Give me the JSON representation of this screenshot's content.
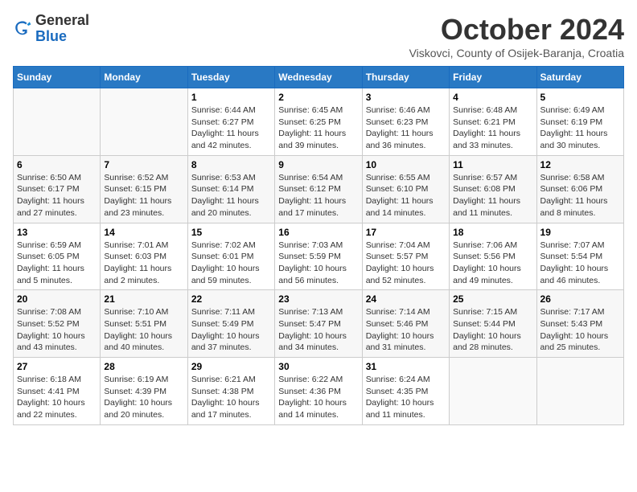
{
  "header": {
    "logo_general": "General",
    "logo_blue": "Blue",
    "month_title": "October 2024",
    "subtitle": "Viskovci, County of Osijek-Baranja, Croatia"
  },
  "calendar": {
    "days_of_week": [
      "Sunday",
      "Monday",
      "Tuesday",
      "Wednesday",
      "Thursday",
      "Friday",
      "Saturday"
    ],
    "weeks": [
      [
        {
          "day": "",
          "sunrise": "",
          "sunset": "",
          "daylight": "",
          "empty": true
        },
        {
          "day": "",
          "sunrise": "",
          "sunset": "",
          "daylight": "",
          "empty": true
        },
        {
          "day": "1",
          "sunrise": "Sunrise: 6:44 AM",
          "sunset": "Sunset: 6:27 PM",
          "daylight": "Daylight: 11 hours and 42 minutes.",
          "empty": false
        },
        {
          "day": "2",
          "sunrise": "Sunrise: 6:45 AM",
          "sunset": "Sunset: 6:25 PM",
          "daylight": "Daylight: 11 hours and 39 minutes.",
          "empty": false
        },
        {
          "day": "3",
          "sunrise": "Sunrise: 6:46 AM",
          "sunset": "Sunset: 6:23 PM",
          "daylight": "Daylight: 11 hours and 36 minutes.",
          "empty": false
        },
        {
          "day": "4",
          "sunrise": "Sunrise: 6:48 AM",
          "sunset": "Sunset: 6:21 PM",
          "daylight": "Daylight: 11 hours and 33 minutes.",
          "empty": false
        },
        {
          "day": "5",
          "sunrise": "Sunrise: 6:49 AM",
          "sunset": "Sunset: 6:19 PM",
          "daylight": "Daylight: 11 hours and 30 minutes.",
          "empty": false
        }
      ],
      [
        {
          "day": "6",
          "sunrise": "Sunrise: 6:50 AM",
          "sunset": "Sunset: 6:17 PM",
          "daylight": "Daylight: 11 hours and 27 minutes.",
          "empty": false
        },
        {
          "day": "7",
          "sunrise": "Sunrise: 6:52 AM",
          "sunset": "Sunset: 6:15 PM",
          "daylight": "Daylight: 11 hours and 23 minutes.",
          "empty": false
        },
        {
          "day": "8",
          "sunrise": "Sunrise: 6:53 AM",
          "sunset": "Sunset: 6:14 PM",
          "daylight": "Daylight: 11 hours and 20 minutes.",
          "empty": false
        },
        {
          "day": "9",
          "sunrise": "Sunrise: 6:54 AM",
          "sunset": "Sunset: 6:12 PM",
          "daylight": "Daylight: 11 hours and 17 minutes.",
          "empty": false
        },
        {
          "day": "10",
          "sunrise": "Sunrise: 6:55 AM",
          "sunset": "Sunset: 6:10 PM",
          "daylight": "Daylight: 11 hours and 14 minutes.",
          "empty": false
        },
        {
          "day": "11",
          "sunrise": "Sunrise: 6:57 AM",
          "sunset": "Sunset: 6:08 PM",
          "daylight": "Daylight: 11 hours and 11 minutes.",
          "empty": false
        },
        {
          "day": "12",
          "sunrise": "Sunrise: 6:58 AM",
          "sunset": "Sunset: 6:06 PM",
          "daylight": "Daylight: 11 hours and 8 minutes.",
          "empty": false
        }
      ],
      [
        {
          "day": "13",
          "sunrise": "Sunrise: 6:59 AM",
          "sunset": "Sunset: 6:05 PM",
          "daylight": "Daylight: 11 hours and 5 minutes.",
          "empty": false
        },
        {
          "day": "14",
          "sunrise": "Sunrise: 7:01 AM",
          "sunset": "Sunset: 6:03 PM",
          "daylight": "Daylight: 11 hours and 2 minutes.",
          "empty": false
        },
        {
          "day": "15",
          "sunrise": "Sunrise: 7:02 AM",
          "sunset": "Sunset: 6:01 PM",
          "daylight": "Daylight: 10 hours and 59 minutes.",
          "empty": false
        },
        {
          "day": "16",
          "sunrise": "Sunrise: 7:03 AM",
          "sunset": "Sunset: 5:59 PM",
          "daylight": "Daylight: 10 hours and 56 minutes.",
          "empty": false
        },
        {
          "day": "17",
          "sunrise": "Sunrise: 7:04 AM",
          "sunset": "Sunset: 5:57 PM",
          "daylight": "Daylight: 10 hours and 52 minutes.",
          "empty": false
        },
        {
          "day": "18",
          "sunrise": "Sunrise: 7:06 AM",
          "sunset": "Sunset: 5:56 PM",
          "daylight": "Daylight: 10 hours and 49 minutes.",
          "empty": false
        },
        {
          "day": "19",
          "sunrise": "Sunrise: 7:07 AM",
          "sunset": "Sunset: 5:54 PM",
          "daylight": "Daylight: 10 hours and 46 minutes.",
          "empty": false
        }
      ],
      [
        {
          "day": "20",
          "sunrise": "Sunrise: 7:08 AM",
          "sunset": "Sunset: 5:52 PM",
          "daylight": "Daylight: 10 hours and 43 minutes.",
          "empty": false
        },
        {
          "day": "21",
          "sunrise": "Sunrise: 7:10 AM",
          "sunset": "Sunset: 5:51 PM",
          "daylight": "Daylight: 10 hours and 40 minutes.",
          "empty": false
        },
        {
          "day": "22",
          "sunrise": "Sunrise: 7:11 AM",
          "sunset": "Sunset: 5:49 PM",
          "daylight": "Daylight: 10 hours and 37 minutes.",
          "empty": false
        },
        {
          "day": "23",
          "sunrise": "Sunrise: 7:13 AM",
          "sunset": "Sunset: 5:47 PM",
          "daylight": "Daylight: 10 hours and 34 minutes.",
          "empty": false
        },
        {
          "day": "24",
          "sunrise": "Sunrise: 7:14 AM",
          "sunset": "Sunset: 5:46 PM",
          "daylight": "Daylight: 10 hours and 31 minutes.",
          "empty": false
        },
        {
          "day": "25",
          "sunrise": "Sunrise: 7:15 AM",
          "sunset": "Sunset: 5:44 PM",
          "daylight": "Daylight: 10 hours and 28 minutes.",
          "empty": false
        },
        {
          "day": "26",
          "sunrise": "Sunrise: 7:17 AM",
          "sunset": "Sunset: 5:43 PM",
          "daylight": "Daylight: 10 hours and 25 minutes.",
          "empty": false
        }
      ],
      [
        {
          "day": "27",
          "sunrise": "Sunrise: 6:18 AM",
          "sunset": "Sunset: 4:41 PM",
          "daylight": "Daylight: 10 hours and 22 minutes.",
          "empty": false
        },
        {
          "day": "28",
          "sunrise": "Sunrise: 6:19 AM",
          "sunset": "Sunset: 4:39 PM",
          "daylight": "Daylight: 10 hours and 20 minutes.",
          "empty": false
        },
        {
          "day": "29",
          "sunrise": "Sunrise: 6:21 AM",
          "sunset": "Sunset: 4:38 PM",
          "daylight": "Daylight: 10 hours and 17 minutes.",
          "empty": false
        },
        {
          "day": "30",
          "sunrise": "Sunrise: 6:22 AM",
          "sunset": "Sunset: 4:36 PM",
          "daylight": "Daylight: 10 hours and 14 minutes.",
          "empty": false
        },
        {
          "day": "31",
          "sunrise": "Sunrise: 6:24 AM",
          "sunset": "Sunset: 4:35 PM",
          "daylight": "Daylight: 10 hours and 11 minutes.",
          "empty": false
        },
        {
          "day": "",
          "sunrise": "",
          "sunset": "",
          "daylight": "",
          "empty": true
        },
        {
          "day": "",
          "sunrise": "",
          "sunset": "",
          "daylight": "",
          "empty": true
        }
      ]
    ]
  }
}
